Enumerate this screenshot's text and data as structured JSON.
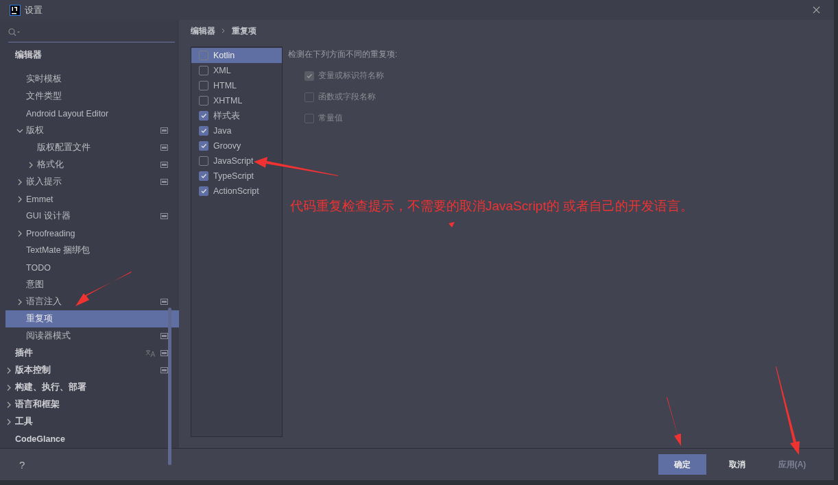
{
  "window": {
    "title": "设置"
  },
  "sidebar": {
    "tree": [
      {
        "label": "编辑器",
        "selected": false,
        "children": [
          {
            "label": "实时模板",
            "selected": false
          },
          {
            "label": "文件类型",
            "selected": false
          },
          {
            "label": "Android Layout Editor",
            "selected": false
          },
          {
            "label": "版权",
            "selected": false,
            "expanded": true,
            "project_icon": true,
            "children": [
              {
                "label": "版权配置文件",
                "selected": false,
                "project_icon": true
              },
              {
                "label": "格式化",
                "selected": false,
                "expanded": false,
                "project_icon": true
              }
            ]
          },
          {
            "label": "嵌入提示",
            "selected": false,
            "expanded": false,
            "project_icon": true
          },
          {
            "label": "Emmet",
            "selected": false,
            "expanded": false
          },
          {
            "label": "GUI 设计器",
            "selected": false,
            "project_icon": true
          },
          {
            "label": "Proofreading",
            "selected": false,
            "expanded": false
          },
          {
            "label": "TextMate 捆绑包",
            "selected": false
          },
          {
            "label": "TODO",
            "selected": false
          },
          {
            "label": "意图",
            "selected": false
          },
          {
            "label": "语言注入",
            "selected": false,
            "expanded": false,
            "project_icon": true
          },
          {
            "label": "重复项",
            "selected": true
          },
          {
            "label": "阅读器模式",
            "selected": false,
            "project_icon": true
          }
        ]
      },
      {
        "label": "插件",
        "selected": false,
        "project_icon": true,
        "language_icon": true
      },
      {
        "label": "版本控制",
        "selected": false,
        "expanded": false,
        "project_icon": true
      },
      {
        "label": "构建、执行、部署",
        "selected": false,
        "expanded": false
      },
      {
        "label": "语言和框架",
        "selected": false,
        "expanded": false
      },
      {
        "label": "工具",
        "selected": false,
        "expanded": false
      },
      {
        "label": "CodeGlance",
        "selected": false
      }
    ]
  },
  "breadcrumb": [
    "编辑器",
    "重复项"
  ],
  "languages": [
    {
      "label": "Kotlin",
      "checked": false,
      "selected": true
    },
    {
      "label": "XML",
      "checked": false,
      "selected": false
    },
    {
      "label": "HTML",
      "checked": false,
      "selected": false
    },
    {
      "label": "XHTML",
      "checked": false,
      "selected": false
    },
    {
      "label": "样式表",
      "checked": true,
      "selected": false
    },
    {
      "label": "Java",
      "checked": true,
      "selected": false
    },
    {
      "label": "Groovy",
      "checked": true,
      "selected": false
    },
    {
      "label": "JavaScript",
      "checked": false,
      "selected": false
    },
    {
      "label": "TypeScript",
      "checked": true,
      "selected": false
    },
    {
      "label": "ActionScript",
      "checked": true,
      "selected": false
    }
  ],
  "options": {
    "heading": "检测在下列方面不同的重复项:",
    "items": [
      {
        "label": "变量或标识符名称",
        "checked": true,
        "disabled": true
      },
      {
        "label": "函数或字段名称",
        "checked": false,
        "disabled": true
      },
      {
        "label": "常量值",
        "checked": false,
        "disabled": true
      }
    ]
  },
  "annotation": {
    "text": "代码重复检查提示，不需要的取消JavaScript的 或者自己的开发语言。"
  },
  "footer": {
    "help": "?",
    "buttons": [
      {
        "label": "确定",
        "kind": "primary",
        "disabled": false
      },
      {
        "label": "取消",
        "kind": "plain",
        "disabled": false
      },
      {
        "label": "应用(A)",
        "kind": "plain",
        "disabled": true
      }
    ]
  }
}
